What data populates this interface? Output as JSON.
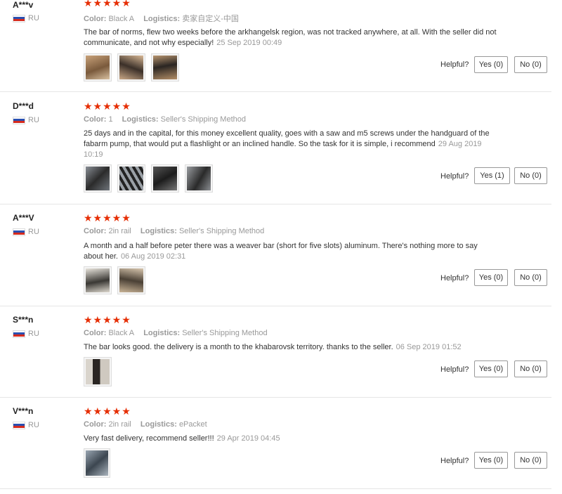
{
  "labels": {
    "color": "Color:",
    "logistics": "Logistics:",
    "helpful": "Helpful?"
  },
  "stars": "★★★★★",
  "colors": {
    "star": "#e62e04",
    "meta": "#999999",
    "text": "#333333",
    "divider": "#e6e6e6"
  },
  "reviews": [
    {
      "user": "A***v",
      "country": "RU",
      "rating": 5,
      "color": "Black A",
      "logistics": "卖家自定义-中国",
      "text": "The bar of norms, flew two weeks before the arkhangelsk region, was not tracked anywhere, at all. With the seller did not communicate, and not why especially!",
      "date": "25 Sep 2019 00:49",
      "photos": 3,
      "yes": "Yes (0)",
      "no": "No (0)"
    },
    {
      "user": "D***d",
      "country": "RU",
      "rating": 5,
      "color": "1",
      "logistics": "Seller's Shipping Method",
      "text": "25 days and in the capital, for this money excellent quality, goes with a saw and m5 screws under the handguard of the fabarm pump, that would put a flashlight or an inclined handle. So the task for it is simple, i recommend",
      "date": "29 Aug 2019 10:19",
      "photos": 4,
      "yes": "Yes (1)",
      "no": "No (0)"
    },
    {
      "user": "A***V",
      "country": "RU",
      "rating": 5,
      "color": "2in rail",
      "logistics": "Seller's Shipping Method",
      "text": "A month and a half before peter there was a weaver bar (short for five slots) aluminum. There's nothing more to say about her.",
      "date": "06 Aug 2019 02:31",
      "photos": 2,
      "yes": "Yes (0)",
      "no": "No (0)"
    },
    {
      "user": "S***n",
      "country": "RU",
      "rating": 5,
      "color": "Black A",
      "logistics": "Seller's Shipping Method",
      "text": "The bar looks good. the delivery is a month to the khabarovsk territory. thanks to the seller.",
      "date": "06 Sep 2019 01:52",
      "photos": 1,
      "yes": "Yes (0)",
      "no": "No (0)"
    },
    {
      "user": "V***n",
      "country": "RU",
      "rating": 5,
      "color": "2in rail",
      "logistics": "ePacket",
      "text": "Very fast delivery, recommend seller!!!",
      "date": "29 Apr 2019 04:45",
      "photos": 1,
      "yes": "Yes (0)",
      "no": "No (0)"
    }
  ]
}
